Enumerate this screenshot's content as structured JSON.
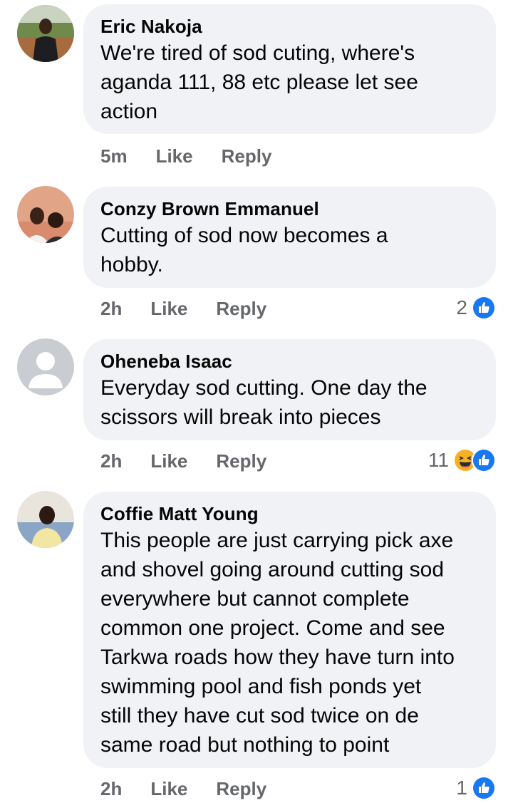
{
  "comments": [
    {
      "author": "Eric Nakoja",
      "text": "We're tired of sod cuting, where's\naganda 111, 88 etc please let see\naction",
      "time": "5m",
      "like_label": "Like",
      "reply_label": "Reply",
      "reaction_count": "",
      "reactions": []
    },
    {
      "author": "Conzy Brown Emmanuel",
      "text": "Cutting of sod now becomes a\nhobby.",
      "time": "2h",
      "like_label": "Like",
      "reply_label": "Reply",
      "reaction_count": "2",
      "reactions": [
        "like-icon"
      ]
    },
    {
      "author": "Oheneba Isaac",
      "text": "Everyday sod cutting. One day the\nscissors will break into pieces",
      "time": "2h",
      "like_label": "Like",
      "reply_label": "Reply",
      "reaction_count": "11",
      "reactions": [
        "haha-icon",
        "like-icon"
      ]
    },
    {
      "author": "Coffie Matt Young",
      "text": "This people are just carrying pick axe\nand shovel going around cutting sod\neverywhere but cannot complete\ncommon one project. Come and see\nTarkwa roads how they have turn into\nswimming pool and fish ponds yet\nstill they have cut sod twice on de\nsame road but nothing to point",
      "time": "2h",
      "like_label": "Like",
      "reply_label": "Reply",
      "reaction_count": "1",
      "reactions": [
        "like-icon"
      ]
    }
  ],
  "colors": {
    "bubble": "#f0f2f5",
    "meta_text": "#65676b",
    "like_blue": "#1877f2",
    "haha_yellow": "#f7b125"
  }
}
